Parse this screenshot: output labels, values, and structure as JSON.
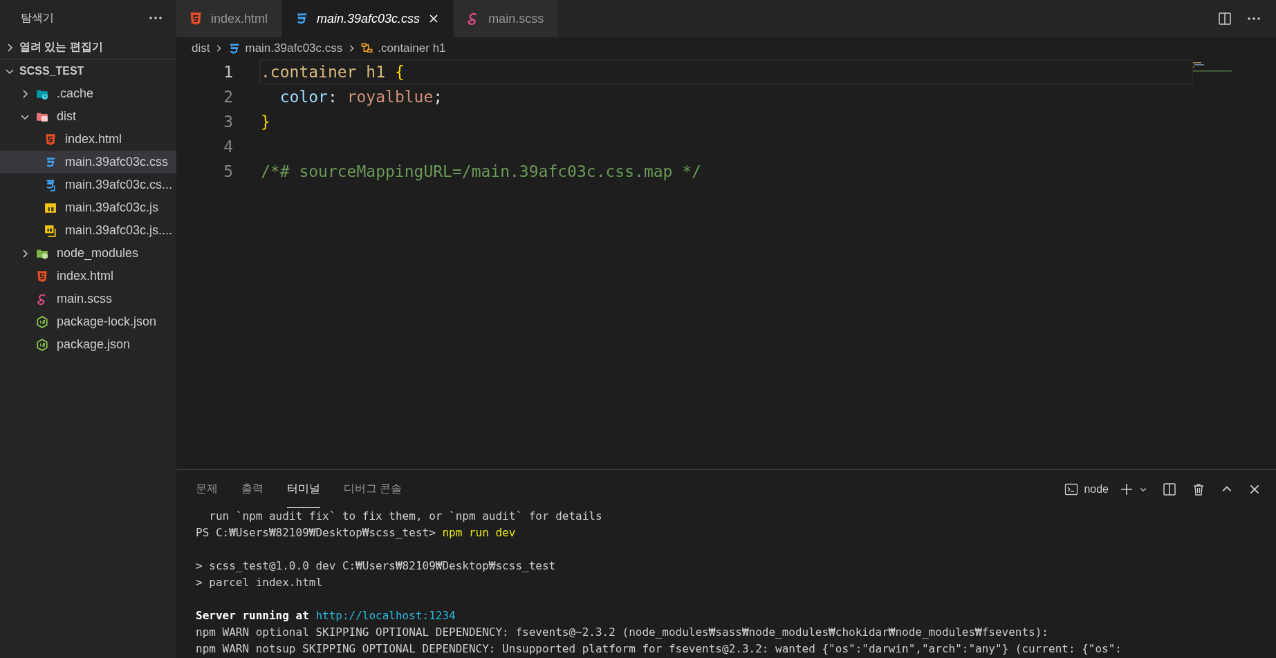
{
  "sidebar": {
    "title": "탐색기",
    "sections": [
      {
        "label": "열려 있는 편집기",
        "expanded": false
      },
      {
        "label": "SCSS_TEST",
        "expanded": true,
        "items": [
          {
            "name": ".cache",
            "kind": "folder-cache",
            "expanded": false,
            "selected": false
          },
          {
            "name": "dist",
            "kind": "folder-dist",
            "expanded": true,
            "selected": false,
            "children": [
              {
                "name": "index.html",
                "kind": "html",
                "selected": false
              },
              {
                "name": "main.39afc03c.css",
                "kind": "css",
                "selected": true
              },
              {
                "name": "main.39afc03c.cs...",
                "kind": "css-map",
                "selected": false
              },
              {
                "name": "main.39afc03c.js",
                "kind": "js",
                "selected": false
              },
              {
                "name": "main.39afc03c.js....",
                "kind": "js-map",
                "selected": false
              }
            ]
          },
          {
            "name": "node_modules",
            "kind": "folder-node",
            "expanded": false,
            "selected": false
          },
          {
            "name": "index.html",
            "kind": "html",
            "selected": false
          },
          {
            "name": "main.scss",
            "kind": "scss",
            "selected": false
          },
          {
            "name": "package-lock.json",
            "kind": "json",
            "selected": false
          },
          {
            "name": "package.json",
            "kind": "json",
            "selected": false
          }
        ]
      }
    ]
  },
  "tabs": [
    {
      "label": "index.html",
      "kind": "html",
      "selected": false
    },
    {
      "label": "main.39afc03c.css",
      "kind": "css",
      "selected": true
    },
    {
      "label": "main.scss",
      "kind": "scss",
      "selected": false
    }
  ],
  "breadcrumb": [
    {
      "label": "dist"
    },
    {
      "label": "main.39afc03c.css",
      "kind": "css"
    },
    {
      "label": ".container h1",
      "kind": "symbol"
    }
  ],
  "editor": {
    "lines": [
      {
        "number": "1",
        "active": true,
        "tokens": [
          {
            "text": ".container h1 ",
            "kind": "selector"
          },
          {
            "text": "{",
            "kind": "brace"
          }
        ]
      },
      {
        "number": "2",
        "active": false,
        "tokens": [
          {
            "text": "  color",
            "kind": "property"
          },
          {
            "text": ": ",
            "kind": "punct"
          },
          {
            "text": "royalblue",
            "kind": "value"
          },
          {
            "text": ";",
            "kind": "punct"
          }
        ]
      },
      {
        "number": "3",
        "active": false,
        "tokens": [
          {
            "text": "}",
            "kind": "brace"
          }
        ]
      },
      {
        "number": "4",
        "active": false
      },
      {
        "number": "5",
        "active": false,
        "tokens": [
          {
            "text": "/*# sourceMappingURL=/main.39afc03c.css.map */",
            "kind": "comment"
          }
        ]
      }
    ]
  },
  "panel": {
    "tabs": [
      {
        "label": "문제",
        "selected": false
      },
      {
        "label": "출력",
        "selected": false
      },
      {
        "label": "터미널",
        "selected": true
      },
      {
        "label": "디버그 콘솔",
        "selected": false
      }
    ],
    "terminal_name": "node",
    "terminal": [
      {
        "segments": [
          {
            "text": "  run `npm audit fix` to fix them, or `npm audit` for details",
            "kind": "plain"
          }
        ]
      },
      {
        "segments": [
          {
            "text": "PS C:₩Users₩82109₩Desktop₩scss_test> ",
            "kind": "plain"
          },
          {
            "text": "npm run dev",
            "kind": "command"
          }
        ]
      },
      {
        "blank": true
      },
      {
        "segments": [
          {
            "text": "> scss_test@1.0.0 dev C:₩Users₩82109₩Desktop₩scss_test",
            "kind": "plain"
          }
        ]
      },
      {
        "segments": [
          {
            "text": "> parcel index.html",
            "kind": "plain"
          }
        ]
      },
      {
        "blank": true
      },
      {
        "segments": [
          {
            "text": "Server running at ",
            "kind": "bold"
          },
          {
            "text": "http://localhost:1234",
            "kind": "link"
          }
        ]
      },
      {
        "segments": [
          {
            "text": "npm WARN optional SKIPPING OPTIONAL DEPENDENCY: fsevents@~2.3.2 (node_modules₩sass₩node_modules₩chokidar₩node_modules₩fsevents):",
            "kind": "plain"
          }
        ]
      },
      {
        "segments": [
          {
            "text": "npm WARN notsup SKIPPING OPTIONAL DEPENDENCY: Unsupported platform for fsevents@2.3.2: wanted {\"os\":\"darwin\",\"arch\":\"any\"} (current: {\"os\":",
            "kind": "plain"
          }
        ]
      }
    ]
  }
}
